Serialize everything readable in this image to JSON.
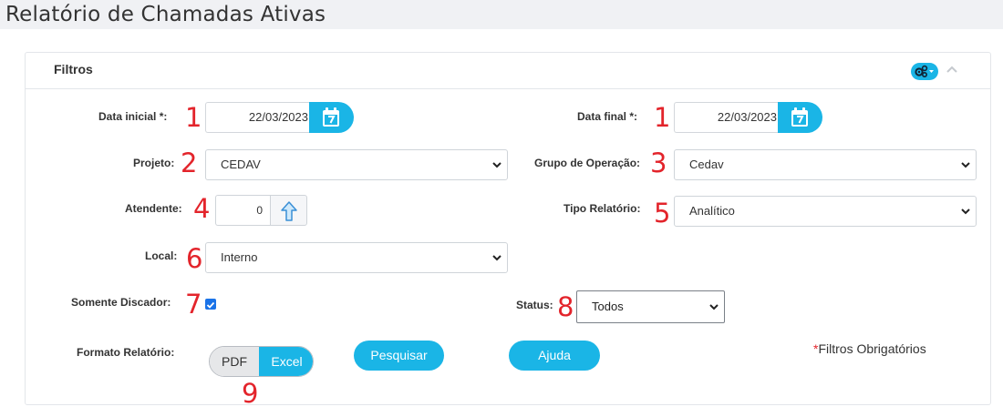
{
  "page_title": "Relatório de Chamadas Ativas",
  "panel": {
    "title": "Filtros",
    "settings_icon": "gears-icon",
    "collapse_icon": "chevron-up-icon"
  },
  "fields": {
    "data_inicial": {
      "label": "Data inicial *:",
      "value": "22/03/2023",
      "marker": "1"
    },
    "data_final": {
      "label": "Data final *:",
      "value": "22/03/2023",
      "marker": "1"
    },
    "projeto": {
      "label": "Projeto:",
      "value": "CEDAV",
      "marker": "2"
    },
    "grupo_operacao": {
      "label": "Grupo de Operação:",
      "value": "Cedav",
      "marker": "3"
    },
    "atendente": {
      "label": "Atendente:",
      "value": "0",
      "marker": "4"
    },
    "tipo_relatorio": {
      "label": "Tipo Relatório:",
      "value": "Analítico",
      "marker": "5"
    },
    "local": {
      "label": "Local:",
      "value": "Interno",
      "marker": "6"
    },
    "somente_discador": {
      "label": "Somente Discador:",
      "checked": true,
      "marker": "7"
    },
    "status": {
      "label": "Status:",
      "value": "Todos",
      "marker": "8"
    },
    "formato_relatorio": {
      "label": "Formato Relatório:",
      "options": [
        "PDF",
        "Excel"
      ],
      "selected": "Excel",
      "marker": "9"
    }
  },
  "buttons": {
    "pesquisar": "Pesquisar",
    "ajuda": "Ajuda"
  },
  "required_note": {
    "star": "*",
    "text": "Filtros Obrigatórios"
  },
  "colors": {
    "accent": "#1ab5e6",
    "marker": "#e3242b",
    "checkbox": "#1a73e8"
  }
}
